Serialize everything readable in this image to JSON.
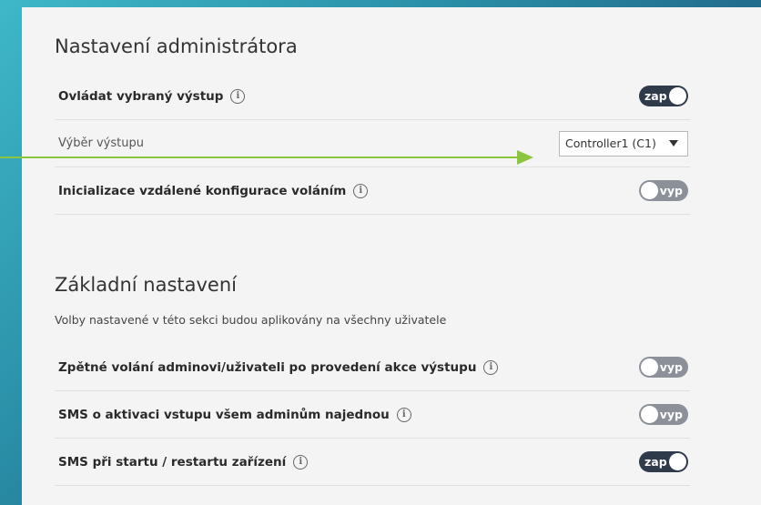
{
  "admin_section": {
    "title": "Nastavení administrátora",
    "rows": [
      {
        "label": "Ovládat vybraný výstup",
        "toggle": "zap",
        "state": "on"
      },
      {
        "label": "Výběr výstupu",
        "select_value": "Controller1 (C1)"
      },
      {
        "label": "Inicializace vzdálené konfigurace voláním",
        "toggle": "vyp",
        "state": "off"
      }
    ]
  },
  "basic_section": {
    "title": "Základní nastavení",
    "subtitle": "Volby nastavené v této sekci budou aplikovány na všechny uživatele",
    "rows": [
      {
        "label": "Zpětné volání adminovi/uživateli po provedení akce výstupu",
        "toggle": "vyp",
        "state": "off"
      },
      {
        "label": "SMS o aktivaci vstupu všem adminům najednou",
        "toggle": "vyp",
        "state": "off"
      },
      {
        "label": "SMS při startu / restartu zařízení",
        "toggle": "zap",
        "state": "on"
      }
    ]
  },
  "info_glyph": "i",
  "colors": {
    "toggle_on": "#2f3a4b",
    "toggle_off": "#8c9099",
    "arrow": "#8cc63f",
    "panel_bg": "#f4f4f4"
  }
}
